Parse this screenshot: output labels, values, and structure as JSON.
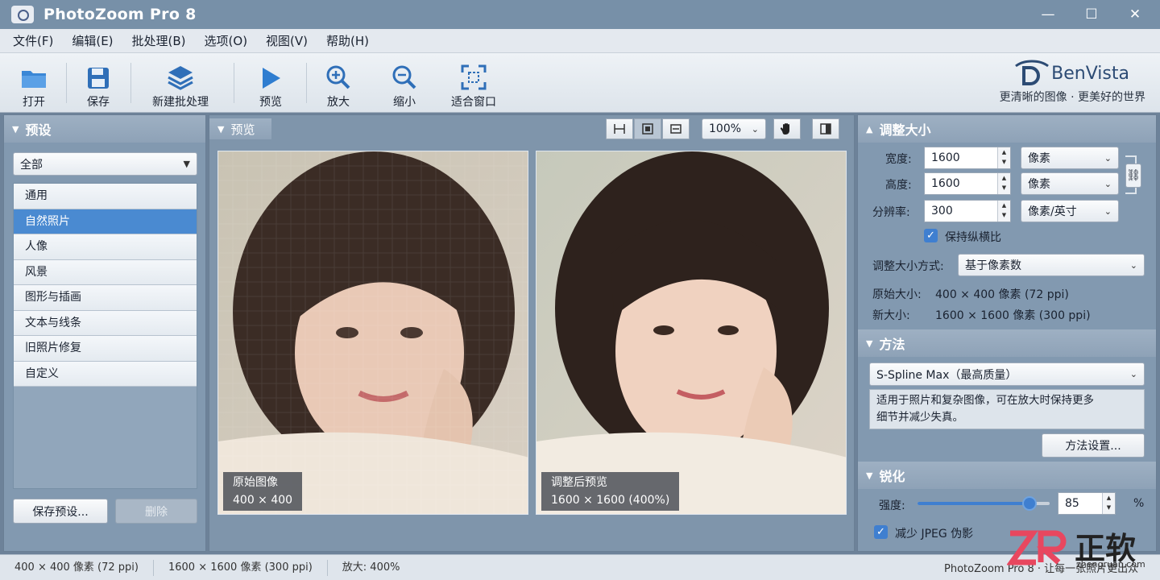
{
  "app": {
    "title": "PhotoZoom Pro 8"
  },
  "menu": [
    "文件(F)",
    "编辑(E)",
    "批处理(B)",
    "选项(O)",
    "视图(V)",
    "帮助(H)"
  ],
  "toolbar": {
    "open": "打开",
    "save": "保存",
    "batch": "新建批处理",
    "preview": "预览",
    "zoom_in": "放大",
    "zoom_out": "缩小",
    "fit": "适合窗口"
  },
  "brand": {
    "name": "BenVista",
    "tagline": "更清晰的图像 · 更美好的世界"
  },
  "presets": {
    "header": "预设",
    "filter": "全部",
    "items": [
      "通用",
      "自然照片",
      "人像",
      "风景",
      "图形与插画",
      "文本与线条",
      "旧照片修复",
      "自定义"
    ],
    "selected_index": 1,
    "save_label": "保存预设...",
    "delete_label": "删除"
  },
  "preview": {
    "header": "预览",
    "zoom": "100%",
    "original_caption": "原始图像",
    "original_size": "400 × 400",
    "result_caption": "调整后预览",
    "result_size": "1600 × 1600 (400%)"
  },
  "resize": {
    "header": "调整大小",
    "width_label": "宽度:",
    "width_value": "1600",
    "width_unit": "像素",
    "height_label": "高度:",
    "height_value": "1600",
    "height_unit": "像素",
    "res_label": "分辨率:",
    "res_value": "300",
    "res_unit": "像素/英寸",
    "keep_ratio": "保持纵横比",
    "method_label": "调整大小方式:",
    "method_value": "基于像素数",
    "orig_label": "原始大小:",
    "orig_value": "400 × 400 像素 (72 ppi)",
    "new_label": "新大小:",
    "new_value": "1600 × 1600 像素 (300 ppi)"
  },
  "method": {
    "header": "方法",
    "value": "S-Spline Max（最高质量）",
    "description_1": "适用于照片和复杂图像，可在放大时保持更多",
    "description_2": "细节并减少失真。",
    "settings_label": "方法设置..."
  },
  "sharpen": {
    "header": "锐化",
    "strength_label": "强度:",
    "strength_value": "85",
    "unit": "%",
    "jpeg_label": "减少 JPEG 伪影",
    "strength_level": 0.85
  },
  "status": {
    "orig": "400 × 400 像素 (72 ppi)",
    "new": "1600 × 1600 像素 (300 ppi)",
    "zoom": "放大: 400%",
    "right": "PhotoZoom Pro 8 · 让每一张照片更出众"
  },
  "watermark": {
    "text": "正软",
    "url": "zhengruan.com"
  }
}
